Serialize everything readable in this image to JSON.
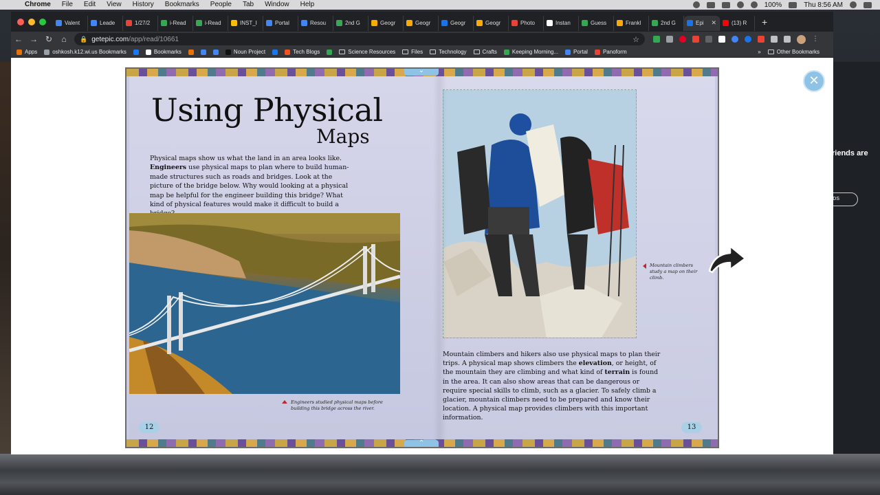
{
  "menubar": {
    "app": "Chrome",
    "items": [
      "File",
      "Edit",
      "View",
      "History",
      "Bookmarks",
      "People",
      "Tab",
      "Window",
      "Help"
    ],
    "battery": "100%",
    "clock": "Thu 8:56 AM"
  },
  "tabs": [
    {
      "label": "Valent",
      "color": "#4285f4"
    },
    {
      "label": "Leade",
      "color": "#4285f4"
    },
    {
      "label": "1/27/2",
      "color": "#ea4335"
    },
    {
      "label": "i-Read",
      "color": "#34a853"
    },
    {
      "label": "i-Read",
      "color": "#34a853"
    },
    {
      "label": "INST_I",
      "color": "#fbbc04"
    },
    {
      "label": "Portal",
      "color": "#4285f4"
    },
    {
      "label": "Resou",
      "color": "#4285f4"
    },
    {
      "label": "2nd G",
      "color": "#34a853"
    },
    {
      "label": "Geogr",
      "color": "#f9ab00"
    },
    {
      "label": "Geogr",
      "color": "#f9ab00"
    },
    {
      "label": "Geogr",
      "color": "#1a73e8"
    },
    {
      "label": "Geogr",
      "color": "#f9ab00"
    },
    {
      "label": "Photo",
      "color": "#ea4335"
    },
    {
      "label": "Instan",
      "color": "#ffffff"
    },
    {
      "label": "Guess",
      "color": "#34a853"
    },
    {
      "label": "Frankl",
      "color": "#f9ab00"
    },
    {
      "label": "2nd G",
      "color": "#34a853"
    },
    {
      "label": "Epi",
      "color": "#1a73e8",
      "active": true
    },
    {
      "label": "(13) R",
      "color": "#ff0000"
    }
  ],
  "toolbar": {
    "url_host": "getepic.com",
    "url_path": "/app/read/10661"
  },
  "bookmarks": {
    "items": [
      {
        "label": "Apps",
        "color": "#e8710a"
      },
      {
        "label": "oshkosh.k12.wi.us Bookmarks",
        "color": "#9aa0a6"
      },
      {
        "label": "",
        "color": "#1877f2"
      },
      {
        "label": "Bookmarks",
        "color": "#ffffff"
      },
      {
        "label": "",
        "color": "#e8710a"
      },
      {
        "label": "",
        "color": "#4285f4"
      },
      {
        "label": "",
        "color": "#4285f4"
      },
      {
        "label": "Noun Project",
        "color": "#111111"
      },
      {
        "label": "",
        "color": "#1877f2"
      },
      {
        "label": "Tech Blogs",
        "color": "#f4511e"
      },
      {
        "label": "",
        "color": "#34a853"
      },
      {
        "label": "Science Resources",
        "color": "folder"
      },
      {
        "label": "Files",
        "color": "folder"
      },
      {
        "label": "Technology",
        "color": "folder"
      },
      {
        "label": "Crafts",
        "color": "folder"
      },
      {
        "label": "Keeping Morning...",
        "color": "#34a853"
      },
      {
        "label": "Portal",
        "color": "#4285f4"
      },
      {
        "label": "Panoform",
        "color": "#ea4335"
      }
    ],
    "overflow": "»",
    "other": "Other Bookmarks"
  },
  "book": {
    "title_line1": "Using Physical",
    "title_line2": "Maps",
    "intro_pre": "Physical maps show us what the land in an area looks like. ",
    "intro_bold": "Engineers",
    "intro_post": " use physical maps to plan where to build human-made structures such as roads and bridges. Look at the picture of the bridge below. Why would looking at a physical map be helpful for the engineer building this bridge? What kind of physical features would make it difficult to build a bridge?",
    "caption_left": "Engineers studied physical maps before building this bridge across the river.",
    "caption_right": "Mountain climbers study a map on their climb.",
    "body_pre": "Mountain climbers and hikers also use physical maps to plan their trips. A physical map shows climbers the ",
    "body_bold1": "elevation",
    "body_mid": ", or height, of the mountain they are climbing and what kind of ",
    "body_bold2": "terrain",
    "body_post": " is found in the area. It can also show areas that can be dangerous or require special skills to climb, such as a glacier. To safely climb a glacier, mountain climbers need to be prepared and know their location. A physical map provides climbers with this important information.",
    "page_left": "12",
    "page_right": "13"
  },
  "desktop": {
    "friends_text": "riends are",
    "pill_text": "IDS"
  }
}
